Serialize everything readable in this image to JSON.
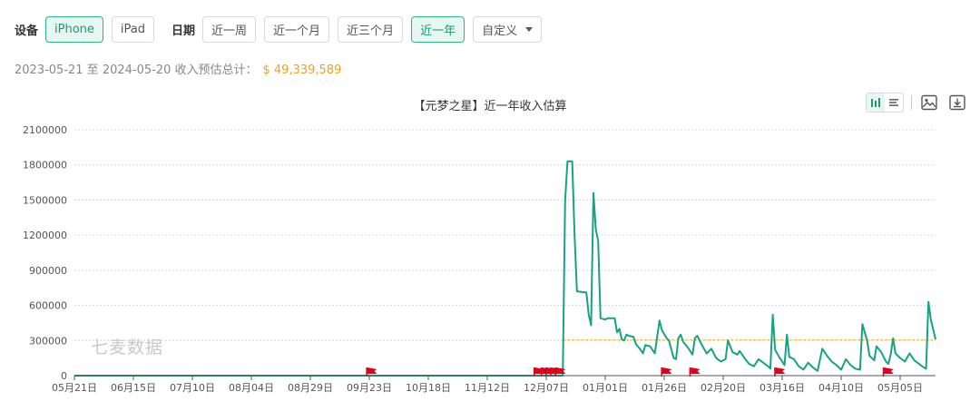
{
  "filters": {
    "device_label": "设备",
    "devices": [
      "iPhone",
      "iPad"
    ],
    "device_selected": "iPhone",
    "date_label": "日期",
    "ranges": [
      "近一周",
      "近一个月",
      "近三个月",
      "近一年"
    ],
    "range_selected": "近一年",
    "custom_label": "自定义"
  },
  "summary": {
    "text": "2023-05-21 至 2024-05-20 收入预估总计：",
    "amount": "$ 49,339,589"
  },
  "watermark": "七麦数据",
  "colors": {
    "accent": "#2db48a",
    "line": "#17a285",
    "average": "#f5c242",
    "flag": "#e0001b"
  },
  "icons": [
    "bar-chart-icon",
    "list-icon",
    "image-icon",
    "download-icon"
  ],
  "chart_data": {
    "type": "line",
    "title": "【元梦之星】近一年收入估算",
    "xlabel": "",
    "ylabel": "",
    "ylim": [
      0,
      2100000
    ],
    "yticks": [
      0,
      300000,
      600000,
      900000,
      1200000,
      1500000,
      1800000,
      2100000
    ],
    "xlim": [
      "2023-05-21",
      "2024-05-20"
    ],
    "xticks": [
      "2023-05-21",
      "2023-06-15",
      "2023-07-10",
      "2023-08-04",
      "2023-08-29",
      "2023-09-23",
      "2023-10-18",
      "2023-11-12",
      "2023-12-07",
      "2024-01-01",
      "2024-01-26",
      "2024-02-20",
      "2024-03-16",
      "2024-04-10",
      "2024-05-05"
    ],
    "xtick_labels": [
      "05月21日",
      "06月15日",
      "07月10日",
      "08月04日",
      "08月29日",
      "09月23日",
      "10月18日",
      "11月12日",
      "12月07日",
      "01月01日",
      "01月26日",
      "02月20日",
      "03月16日",
      "04月10日",
      "05月05日"
    ],
    "grid": true,
    "legend": "none",
    "series": [
      {
        "points": [
          [
            "2023-05-21",
            0
          ],
          [
            "2023-12-14",
            0
          ],
          [
            "2023-12-15",
            1500000
          ],
          [
            "2023-12-16",
            1830000
          ],
          [
            "2023-12-18",
            1830000
          ],
          [
            "2023-12-19",
            1200000
          ],
          [
            "2023-12-20",
            720000
          ],
          [
            "2023-12-24",
            710000
          ],
          [
            "2023-12-25",
            520000
          ],
          [
            "2023-12-26",
            430000
          ],
          [
            "2023-12-27",
            1560000
          ],
          [
            "2023-12-28",
            1250000
          ],
          [
            "2023-12-29",
            1150000
          ],
          [
            "2023-12-30",
            490000
          ],
          [
            "2024-01-01",
            480000
          ],
          [
            "2024-01-02",
            490000
          ],
          [
            "2024-01-05",
            490000
          ],
          [
            "2024-01-06",
            370000
          ],
          [
            "2024-01-07",
            400000
          ],
          [
            "2024-01-08",
            310000
          ],
          [
            "2024-01-09",
            300000
          ],
          [
            "2024-01-10",
            350000
          ],
          [
            "2024-01-11",
            340000
          ],
          [
            "2024-01-13",
            330000
          ],
          [
            "2024-01-14",
            270000
          ],
          [
            "2024-01-16",
            220000
          ],
          [
            "2024-01-17",
            190000
          ],
          [
            "2024-01-18",
            260000
          ],
          [
            "2024-01-20",
            250000
          ],
          [
            "2024-01-22",
            190000
          ],
          [
            "2024-01-23",
            330000
          ],
          [
            "2024-01-24",
            470000
          ],
          [
            "2024-01-25",
            390000
          ],
          [
            "2024-01-27",
            320000
          ],
          [
            "2024-01-28",
            300000
          ],
          [
            "2024-01-30",
            150000
          ],
          [
            "2024-01-31",
            140000
          ],
          [
            "2024-02-01",
            320000
          ],
          [
            "2024-02-02",
            350000
          ],
          [
            "2024-02-03",
            290000
          ],
          [
            "2024-02-05",
            240000
          ],
          [
            "2024-02-07",
            180000
          ],
          [
            "2024-02-08",
            320000
          ],
          [
            "2024-02-09",
            340000
          ],
          [
            "2024-02-11",
            260000
          ],
          [
            "2024-02-13",
            190000
          ],
          [
            "2024-02-15",
            230000
          ],
          [
            "2024-02-17",
            150000
          ],
          [
            "2024-02-19",
            120000
          ],
          [
            "2024-02-21",
            140000
          ],
          [
            "2024-02-22",
            300000
          ],
          [
            "2024-02-24",
            200000
          ],
          [
            "2024-02-26",
            180000
          ],
          [
            "2024-02-27",
            210000
          ],
          [
            "2024-02-29",
            150000
          ],
          [
            "2024-03-02",
            100000
          ],
          [
            "2024-03-04",
            80000
          ],
          [
            "2024-03-06",
            140000
          ],
          [
            "2024-03-08",
            110000
          ],
          [
            "2024-03-10",
            80000
          ],
          [
            "2024-03-11",
            60000
          ],
          [
            "2024-03-12",
            520000
          ],
          [
            "2024-03-13",
            220000
          ],
          [
            "2024-03-15",
            150000
          ],
          [
            "2024-03-17",
            90000
          ],
          [
            "2024-03-18",
            350000
          ],
          [
            "2024-03-19",
            160000
          ],
          [
            "2024-03-21",
            140000
          ],
          [
            "2024-03-23",
            80000
          ],
          [
            "2024-03-25",
            50000
          ],
          [
            "2024-03-27",
            110000
          ],
          [
            "2024-03-29",
            70000
          ],
          [
            "2024-03-31",
            40000
          ],
          [
            "2024-04-02",
            230000
          ],
          [
            "2024-04-04",
            170000
          ],
          [
            "2024-04-06",
            120000
          ],
          [
            "2024-04-08",
            90000
          ],
          [
            "2024-04-10",
            50000
          ],
          [
            "2024-04-12",
            140000
          ],
          [
            "2024-04-14",
            90000
          ],
          [
            "2024-04-16",
            60000
          ],
          [
            "2024-04-18",
            50000
          ],
          [
            "2024-04-19",
            440000
          ],
          [
            "2024-04-21",
            300000
          ],
          [
            "2024-04-22",
            170000
          ],
          [
            "2024-04-24",
            130000
          ],
          [
            "2024-04-25",
            250000
          ],
          [
            "2024-04-27",
            200000
          ],
          [
            "2024-04-29",
            120000
          ],
          [
            "2024-04-30",
            100000
          ],
          [
            "2024-05-01",
            180000
          ],
          [
            "2024-05-02",
            320000
          ],
          [
            "2024-05-03",
            190000
          ],
          [
            "2024-05-05",
            150000
          ],
          [
            "2024-05-07",
            120000
          ],
          [
            "2024-05-09",
            190000
          ],
          [
            "2024-05-11",
            130000
          ],
          [
            "2024-05-13",
            100000
          ],
          [
            "2024-05-15",
            70000
          ],
          [
            "2024-05-16",
            60000
          ],
          [
            "2024-05-17",
            630000
          ],
          [
            "2024-05-18",
            480000
          ],
          [
            "2024-05-20",
            310000
          ]
        ]
      }
    ],
    "average_line": {
      "value": 305000,
      "from": "2023-12-14",
      "to": "2024-05-20"
    },
    "event_flags": [
      "2023-09-22",
      "2023-12-02",
      "2023-12-05",
      "2023-12-07",
      "2023-12-09",
      "2023-12-11",
      "2024-01-25",
      "2024-02-06",
      "2024-03-13",
      "2024-04-28"
    ]
  }
}
